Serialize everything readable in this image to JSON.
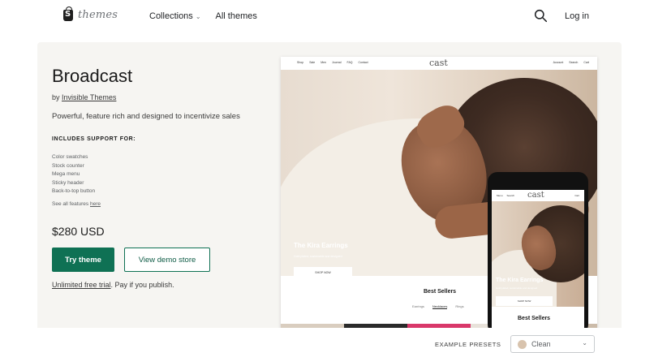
{
  "header": {
    "logo_text": "themes",
    "nav": [
      {
        "label": "Collections",
        "has_caret": true
      },
      {
        "label": "All themes",
        "has_caret": false
      }
    ],
    "search_icon": "search-icon",
    "login_label": "Log in"
  },
  "theme": {
    "title": "Broadcast",
    "by_prefix": "by",
    "author": "Invisible Themes",
    "description": "Powerful, feature rich and designed to incentivize sales",
    "support_title": "INCLUDES SUPPORT FOR:",
    "features": [
      "Color swatches",
      "Stock counter",
      "Mega menu",
      "Sticky header",
      "Back-to-top button"
    ],
    "see_all_prefix": "See all features",
    "see_all_link": "here",
    "price": "$280 USD",
    "try_button": "Try theme",
    "demo_button": "View demo store",
    "trial_link": "Unlimited free trial",
    "trial_suffix": ". Pay if you publish."
  },
  "preview": {
    "desktop": {
      "brand": "cast",
      "nav_left": [
        "Shop",
        "Sale",
        "Men",
        "Journal",
        "FAQ",
        "Contact"
      ],
      "nav_right": [
        "Account",
        "Search",
        "Cart"
      ],
      "hero_title": "The Kira Earrings",
      "hero_sub": "Gold plated, sustainable and designed",
      "hero_button": "SHOP NOW",
      "section_title": "Best Sellers",
      "tabs": [
        "Earrings",
        "Necklaces",
        "Rings"
      ],
      "active_tab": "Necklaces"
    },
    "mobile": {
      "brand": "cast",
      "nav_left": [
        "Menu",
        "Search"
      ],
      "nav_right": "Cart",
      "hero_title": "The Kira Earrings",
      "hero_sub": "Gold plated, sustainable and designed",
      "hero_button": "SHOP NOW",
      "section_title": "Best Sellers"
    }
  },
  "presets": {
    "label": "EXAMPLE PRESETS",
    "selected": "Clean"
  },
  "colors": {
    "primary_button": "#0f7154",
    "hero_background": "#f6f5f2",
    "strip_accent": "#d9386a"
  }
}
